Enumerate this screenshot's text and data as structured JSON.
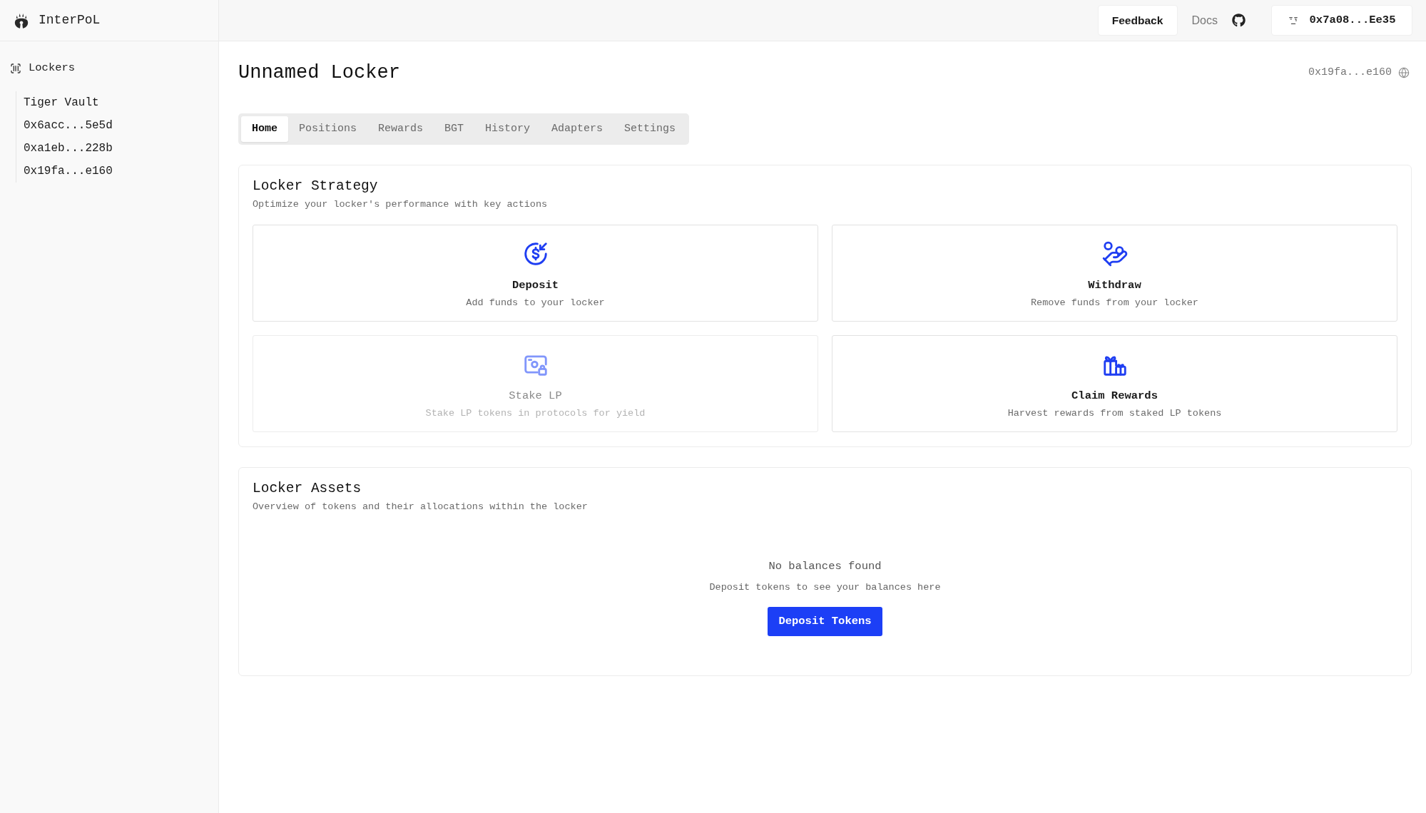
{
  "app": {
    "name": "InterPoL"
  },
  "sidebar": {
    "section": "Lockers",
    "items": [
      "Tiger Vault",
      "0x6acc...5e5d",
      "0xa1eb...228b",
      "0x19fa...e160"
    ]
  },
  "header": {
    "feedback": "Feedback",
    "docs": "Docs",
    "wallet": "0x7a08...Ee35"
  },
  "page": {
    "title": "Unnamed Locker",
    "address": "0x19fa...e160"
  },
  "tabs": [
    {
      "label": "Home",
      "selected": true
    },
    {
      "label": "Positions",
      "selected": false
    },
    {
      "label": "Rewards",
      "selected": false
    },
    {
      "label": "BGT",
      "selected": false
    },
    {
      "label": "History",
      "selected": false
    },
    {
      "label": "Adapters",
      "selected": false
    },
    {
      "label": "Settings",
      "selected": false
    }
  ],
  "strategy": {
    "title": "Locker Strategy",
    "subtitle": "Optimize your locker's performance with key actions",
    "actions": [
      {
        "kind": "deposit",
        "title": "Deposit",
        "description": "Add funds to your locker",
        "disabled": false
      },
      {
        "kind": "withdraw",
        "title": "Withdraw",
        "description": "Remove funds from your locker",
        "disabled": false
      },
      {
        "kind": "stake",
        "title": "Stake LP",
        "description": "Stake LP tokens in protocols for yield",
        "disabled": true
      },
      {
        "kind": "claim",
        "title": "Claim Rewards",
        "description": "Harvest rewards from staked LP tokens",
        "disabled": false
      }
    ]
  },
  "assets": {
    "title": "Locker Assets",
    "subtitle": "Overview of tokens and their allocations within the locker",
    "empty": {
      "title": "No balances found",
      "hint": "Deposit tokens to see your balances here",
      "button": "Deposit Tokens"
    }
  }
}
